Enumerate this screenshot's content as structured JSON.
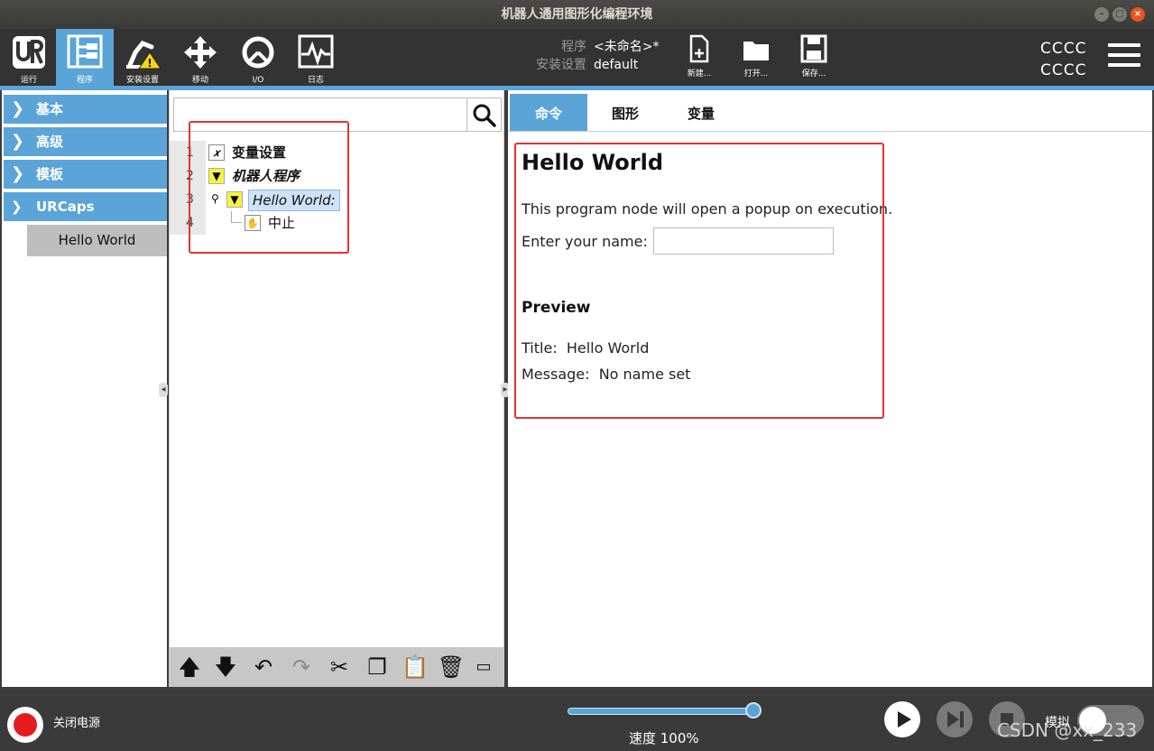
{
  "window": {
    "title": "机器人通用图形化编程环境",
    "buttons": [
      "–",
      "□",
      "×"
    ]
  },
  "header": {
    "nav": [
      {
        "id": "run",
        "label": "运行",
        "icon": "ur-logo-icon"
      },
      {
        "id": "program",
        "label": "程序",
        "icon": "program-tree-icon",
        "active": true
      },
      {
        "id": "installation",
        "label": "安装设置",
        "icon": "robot-arm-warning-icon"
      },
      {
        "id": "move",
        "label": "移动",
        "icon": "move-arrows-icon"
      },
      {
        "id": "io",
        "label": "I/O",
        "icon": "io-icon"
      },
      {
        "id": "log",
        "label": "日志",
        "icon": "log-pulse-icon"
      }
    ],
    "program_key": "程序",
    "program_value": "<未命名>*",
    "installation_key": "安装设置",
    "installation_value": "default",
    "file_buttons": [
      {
        "label": "新建...",
        "icon": "new-file-icon"
      },
      {
        "label": "打开...",
        "icon": "open-folder-icon"
      },
      {
        "label": "保存...",
        "icon": "save-disk-icon"
      }
    ],
    "user_line1": "CCCC",
    "user_line2": "CCCC"
  },
  "sidebar": {
    "items": [
      {
        "label": "基本",
        "expanded": false
      },
      {
        "label": "高级",
        "expanded": false
      },
      {
        "label": "模板",
        "expanded": false
      },
      {
        "label": "URCaps",
        "expanded": true
      }
    ],
    "sub_items": [
      {
        "label": "Hello World"
      }
    ]
  },
  "tree": {
    "search_placeholder": "",
    "rows": [
      {
        "num": "1",
        "icon_glyph": "𝑥",
        "label": "变量设置"
      },
      {
        "num": "2",
        "icon_glyph": "▼",
        "label": "机器人程序"
      },
      {
        "num": "3",
        "icon_glyph": "▼",
        "label": "Hello World:"
      },
      {
        "num": "4",
        "icon_glyph": "✋",
        "label": "中止"
      }
    ]
  },
  "content": {
    "tabs": [
      {
        "label": "命令",
        "active": true
      },
      {
        "label": "图形"
      },
      {
        "label": "变量"
      }
    ],
    "title": "Hello World",
    "description": "This program node will open a popup on execution.",
    "name_label": "Enter your name:",
    "name_value": "",
    "preview_heading": "Preview",
    "preview_title_label": "Title:",
    "preview_title_value": "Hello World",
    "preview_message_label": "Message:",
    "preview_message_value": "No name set"
  },
  "footer": {
    "power_label": "关闭电源",
    "speed_text": "速度 100%",
    "speed_percent": 100,
    "simulation_label": "模拟",
    "watermark": "CSDN @xx_233"
  },
  "colors": {
    "accent": "#5aa4d8",
    "annotation_red": "#e53333",
    "tree_yellow": "#f6f242"
  }
}
